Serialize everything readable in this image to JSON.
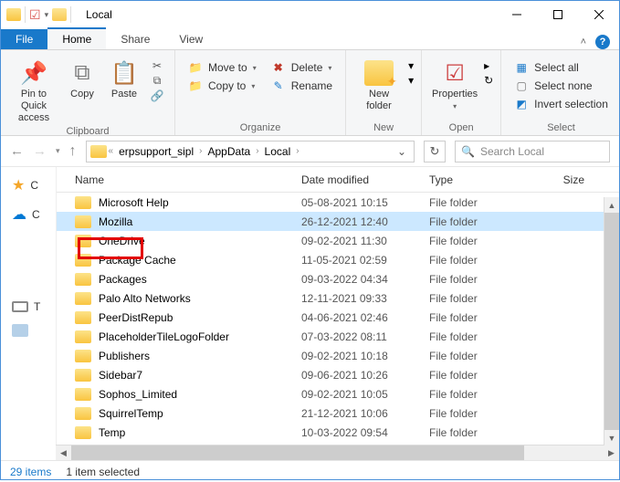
{
  "window": {
    "title": "Local"
  },
  "tabs": {
    "file": "File",
    "home": "Home",
    "share": "Share",
    "view": "View"
  },
  "ribbon": {
    "pin": "Pin to Quick\naccess",
    "copy": "Copy",
    "paste": "Paste",
    "clipboard_label": "Clipboard",
    "moveto": "Move to",
    "copyto": "Copy to",
    "delete": "Delete",
    "rename": "Rename",
    "organize_label": "Organize",
    "newfolder": "New\nfolder",
    "newitem": "",
    "new_label": "New",
    "properties": "Properties",
    "open_label": "Open",
    "selectall": "Select all",
    "selectnone": "Select none",
    "invert": "Invert selection",
    "select_label": "Select"
  },
  "breadcrumbs": [
    "erpsupport_sipl",
    "AppData",
    "Local"
  ],
  "search_placeholder": "Search Local",
  "columns": {
    "name": "Name",
    "date": "Date modified",
    "type": "Type",
    "size": "Size"
  },
  "items": [
    {
      "name": "Microsoft Help",
      "date": "05-08-2021 10:15",
      "type": "File folder"
    },
    {
      "name": "Mozilla",
      "date": "26-12-2021 12:40",
      "type": "File folder",
      "selected": true,
      "highlight": true
    },
    {
      "name": "OneDrive",
      "date": "09-02-2021 11:30",
      "type": "File folder"
    },
    {
      "name": "Package Cache",
      "date": "11-05-2021 02:59",
      "type": "File folder"
    },
    {
      "name": "Packages",
      "date": "09-03-2022 04:34",
      "type": "File folder"
    },
    {
      "name": "Palo Alto Networks",
      "date": "12-11-2021 09:33",
      "type": "File folder"
    },
    {
      "name": "PeerDistRepub",
      "date": "04-06-2021 02:46",
      "type": "File folder"
    },
    {
      "name": "PlaceholderTileLogoFolder",
      "date": "07-03-2022 08:11",
      "type": "File folder"
    },
    {
      "name": "Publishers",
      "date": "09-02-2021 10:18",
      "type": "File folder"
    },
    {
      "name": "Sidebar7",
      "date": "09-06-2021 10:26",
      "type": "File folder"
    },
    {
      "name": "Sophos_Limited",
      "date": "09-02-2021 10:05",
      "type": "File folder"
    },
    {
      "name": "SquirrelTemp",
      "date": "21-12-2021 10:06",
      "type": "File folder"
    },
    {
      "name": "Temp",
      "date": "10-03-2022 09:54",
      "type": "File folder"
    }
  ],
  "status": {
    "count": "29 items",
    "selection": "1 item selected"
  },
  "navpane": {
    "quick": "C",
    "one": "C"
  }
}
